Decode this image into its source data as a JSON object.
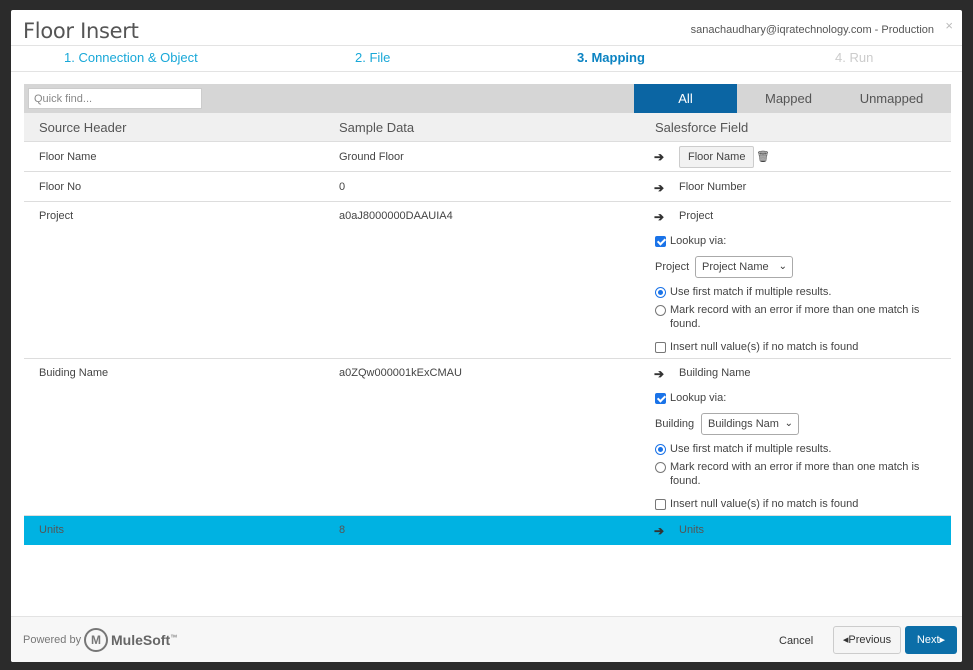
{
  "header": {
    "title": "Floor Insert",
    "user": "sanachaudhary@iqratechnology.com - Production",
    "close_icon": "×"
  },
  "steps": [
    {
      "label": "1. Connection & Object",
      "state": "done"
    },
    {
      "label": "2. File",
      "state": "done"
    },
    {
      "label": "3. Mapping",
      "state": "active"
    },
    {
      "label": "4. Run",
      "state": "disabled"
    }
  ],
  "search": {
    "placeholder": "Quick find...",
    "value": ""
  },
  "filters": [
    {
      "label": "All",
      "active": true
    },
    {
      "label": "Mapped",
      "active": false
    },
    {
      "label": "Unmapped",
      "active": false
    }
  ],
  "columns": {
    "source": "Source Header",
    "sample": "Sample Data",
    "field": "Salesforce Field"
  },
  "rows": [
    {
      "source": "Floor Name",
      "sample": "Ground Floor",
      "field": "Floor Name"
    },
    {
      "source": "Floor No",
      "sample": "0",
      "field": "Floor Number"
    },
    {
      "source": "Project",
      "sample": "a0aJ8000000DAAUIA4",
      "field": "Project",
      "lookup_label": "Lookup via:",
      "select_label": "Project",
      "select_value": "Project Name",
      "opt_first": "Use first match if multiple results.",
      "opt_error": "Mark record with an error if more than one match is found.",
      "opt_null": "Insert null value(s) if no match is found"
    },
    {
      "source": "Buiding Name",
      "sample": "a0ZQw000001kExCMAU",
      "field": "Building Name",
      "lookup_label": "Lookup via:",
      "select_label": "Building",
      "select_value": "Buildings Nam",
      "opt_first": "Use first match if multiple results.",
      "opt_error": "Mark record with an error if more than one match is found.",
      "opt_null": "Insert null value(s) if no match is found"
    },
    {
      "source": "Units",
      "sample": "8",
      "field": "Units"
    }
  ],
  "icons": {
    "arrow": "➔",
    "trash": "🗑",
    "chevron": "⌄",
    "prev": "◂",
    "next": "▸"
  },
  "footer": {
    "powered": "Powered by",
    "brand": "MuleSoft",
    "brand_tm": "™",
    "cancel": "Cancel",
    "previous": "Previous",
    "next": "Next"
  },
  "colors": {
    "accent": "#0b65a3",
    "selected_row": "#00b2e2",
    "link": "#19a8d8"
  }
}
